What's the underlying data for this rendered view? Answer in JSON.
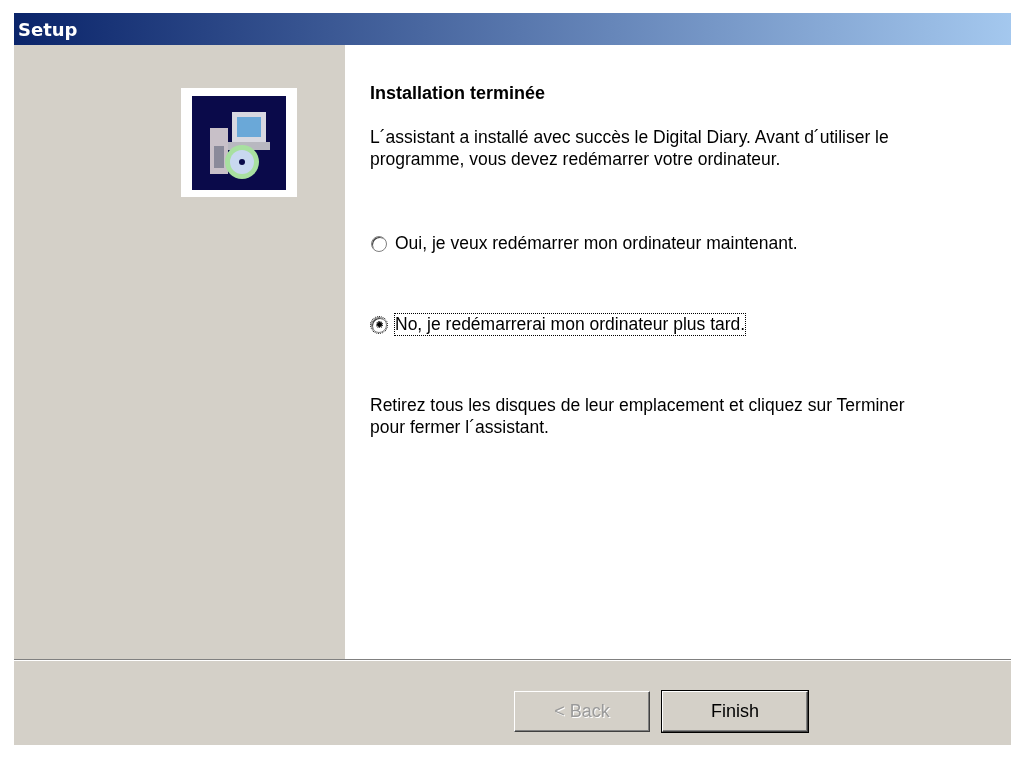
{
  "window": {
    "title": "Setup"
  },
  "heading": "Installation terminée",
  "intro": "L´assistant a installé avec succès le Digital Diary. Avant d´utiliser le programme, vous devez redémarrer votre ordinateur.",
  "options": [
    {
      "label": "Oui, je veux redémarrer mon ordinateur maintenant.",
      "selected": false,
      "focused": false
    },
    {
      "label": "No, je redémarrerai mon ordinateur plus tard.",
      "selected": true,
      "focused": true
    }
  ],
  "note": "Retirez tous les disques de leur emplacement et cliquez sur Terminer pour fermer l´assistant.",
  "buttons": [
    {
      "label": "< Back",
      "disabled": true,
      "default": false
    },
    {
      "label": "Finish",
      "disabled": false,
      "default": true
    }
  ]
}
